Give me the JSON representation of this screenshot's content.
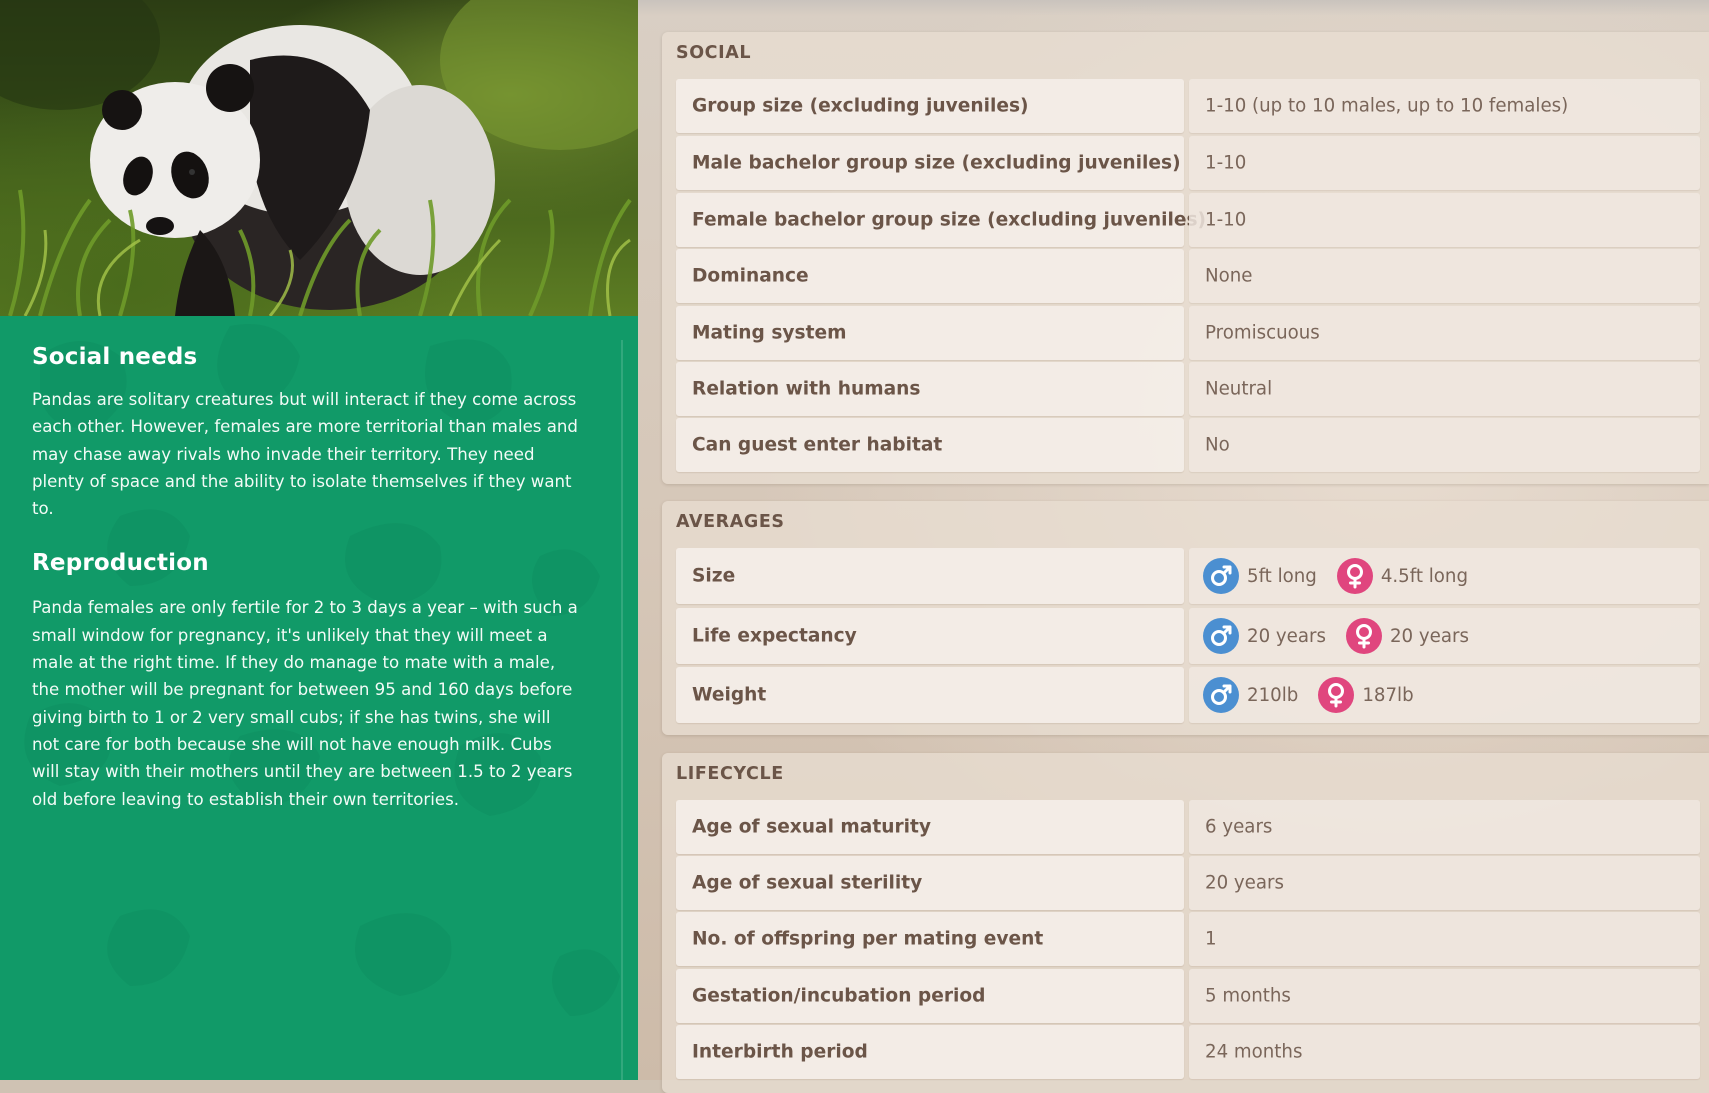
{
  "left": {
    "social_heading": "Social needs",
    "social_text": "Pandas are solitary creatures but will interact if they come across each other. However, females are more territorial than males and may chase away rivals who invade their territory. They need plenty of space and the ability to isolate themselves if they want to.",
    "repro_heading": "Reproduction",
    "repro_text": "Panda females are only fertile for 2 to 3 days a year – with such a small window for pregnancy, it's unlikely that they will meet a male at the right time. If they do manage to mate with a male, the mother will be pregnant for between 95 and 160 days before giving birth to 1 or 2 very small cubs; if she has twins, she will not care for both because she will not have enough milk. Cubs will stay with their mothers until they are between 1.5 to 2 years old before leaving to establish their own territories."
  },
  "social": {
    "title": "SOCIAL",
    "rows": [
      {
        "label": "Group size (excluding juveniles)",
        "value": "1-10 (up to 10 males, up to 10 females)"
      },
      {
        "label": "Male bachelor group size (excluding juveniles)",
        "value": "1-10"
      },
      {
        "label": "Female bachelor group size (excluding juveniles)",
        "value": "1-10"
      },
      {
        "label": "Dominance",
        "value": "None"
      },
      {
        "label": "Mating system",
        "value": "Promiscuous"
      },
      {
        "label": "Relation with humans",
        "value": "Neutral"
      },
      {
        "label": "Can guest enter habitat",
        "value": "No"
      }
    ]
  },
  "averages": {
    "title": "AVERAGES",
    "rows": [
      {
        "label": "Size",
        "male": "5ft long",
        "female": "4.5ft long"
      },
      {
        "label": "Life expectancy",
        "male": "20 years",
        "female": "20 years"
      },
      {
        "label": "Weight",
        "male": "210lb",
        "female": "187lb"
      }
    ]
  },
  "lifecycle": {
    "title": "LIFECYCLE",
    "rows": [
      {
        "label": "Age of sexual maturity",
        "value": "6 years"
      },
      {
        "label": "Age of sexual sterility",
        "value": "20 years"
      },
      {
        "label": "No. of offspring per mating event",
        "value": "1"
      },
      {
        "label": "Gestation/incubation period",
        "value": "5 months"
      },
      {
        "label": "Interbirth period",
        "value": "24 months"
      }
    ]
  },
  "colors": {
    "left_panel": "#119a68",
    "male_icon": "#4b8fd1",
    "female_icon": "#e0467e",
    "label_text": "#6b5548"
  },
  "icons": {
    "male": "male-symbol-icon",
    "female": "female-symbol-icon"
  }
}
